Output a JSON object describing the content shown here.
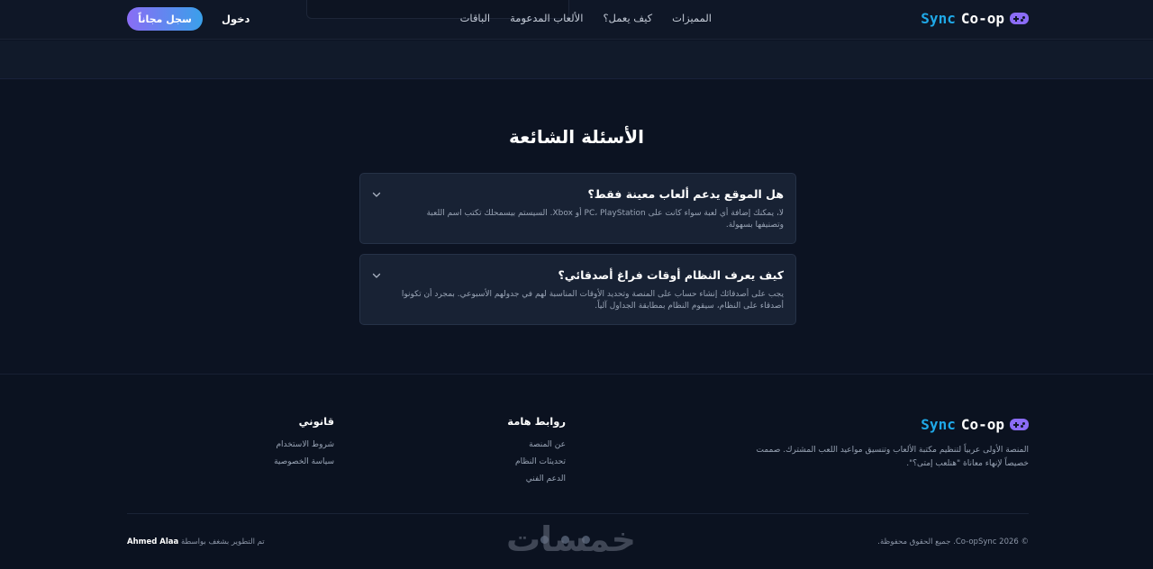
{
  "nav": {
    "logo_word1": "Sync",
    "logo_word2": "Co-op",
    "links": [
      "المميزات",
      "كيف يعمل؟",
      "الألعاب المدعومة",
      "الباقات"
    ],
    "login": "دخول",
    "signup": "سجل مجاناً"
  },
  "faq": {
    "title": "الأسئلة الشائعة",
    "items": [
      {
        "question": "هل الموقع يدعم ألعاب معينة فقط؟",
        "answer": "لا، يمكنك إضافة أي لعبة سواء كانت على PC، PlayStation أو Xbox. السيستم بيسمحلك تكتب اسم اللعبة وتصنيفها بسهولة."
      },
      {
        "question": "كيف يعرف النظام أوقات فراغ أصدقائي؟",
        "answer": "يجب على أصدقائك إنشاء حساب على المنصة وتحديد الأوقات المناسبة لهم في جدولهم الأسبوعي. بمجرد أن تكونوا أصدقاء على النظام، سيقوم النظام بمطابقة الجداول آلياً."
      }
    ]
  },
  "footer": {
    "logo_word1": "Sync",
    "logo_word2": "Co-op",
    "description": "المنصة الأولى عربياً لتنظيم مكتبة الألعاب وتنسيق مواعيد اللعب المشترك. صممت خصيصاً لإنهاء معاناة \"هنلعب إمتى؟\".",
    "links_title": "روابط هامة",
    "links": [
      "عن المنصة",
      "تحديثات النظام",
      "الدعم الفني"
    ],
    "legal_title": "قانوني",
    "legal": [
      "شروط الاستخدام",
      "سياسة الخصوصية"
    ],
    "copyright": "© 2026 Co-opSync. جميع الحقوق محفوظة.",
    "credit_prefix": "تم التطوير بشغف بواسطة",
    "credit_name": "Ahmed Alaa",
    "watermark": "خمسات"
  },
  "colors": {
    "background": "#0c1322",
    "accent_blue": "#1fa9e8",
    "accent_purple": "#8b6cf6"
  }
}
